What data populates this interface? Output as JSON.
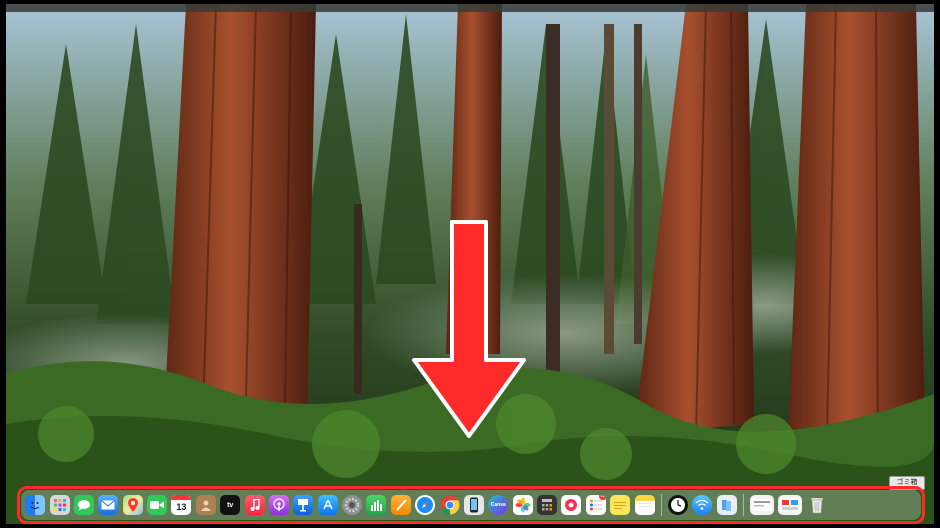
{
  "tooltip": {
    "trash_label": "ゴミ箱"
  },
  "dock": {
    "calendar_day": "13",
    "tv_label": "tv",
    "canva_label": "Canva",
    "calendar_badge": "1",
    "reminders_badge": "12"
  },
  "colors": {
    "highlight": "#ff2b2b",
    "arrow": "#ff2b2b"
  }
}
